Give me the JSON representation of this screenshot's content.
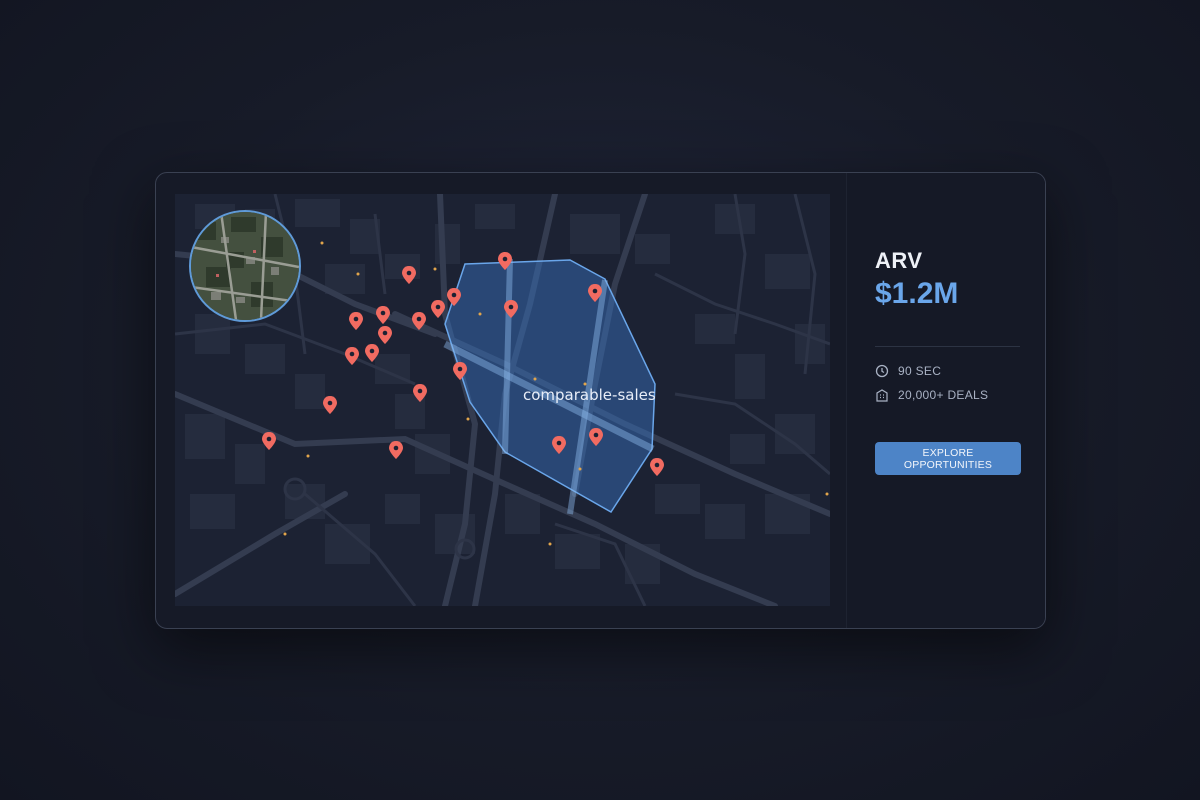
{
  "map": {
    "overlay_label": "comparable-sales",
    "accent_color": "#4d84c7",
    "marker_color": "#f16b61",
    "inset_view": "satellite"
  },
  "panel": {
    "arv_label": "ARV",
    "arv_value": "$1.2M",
    "stats": [
      {
        "icon": "clock-icon",
        "text": "90 SEC"
      },
      {
        "icon": "building-icon",
        "text": "20,000+ DEALS"
      }
    ],
    "cta_label": "EXPLORE OPPORTUNITIES"
  }
}
